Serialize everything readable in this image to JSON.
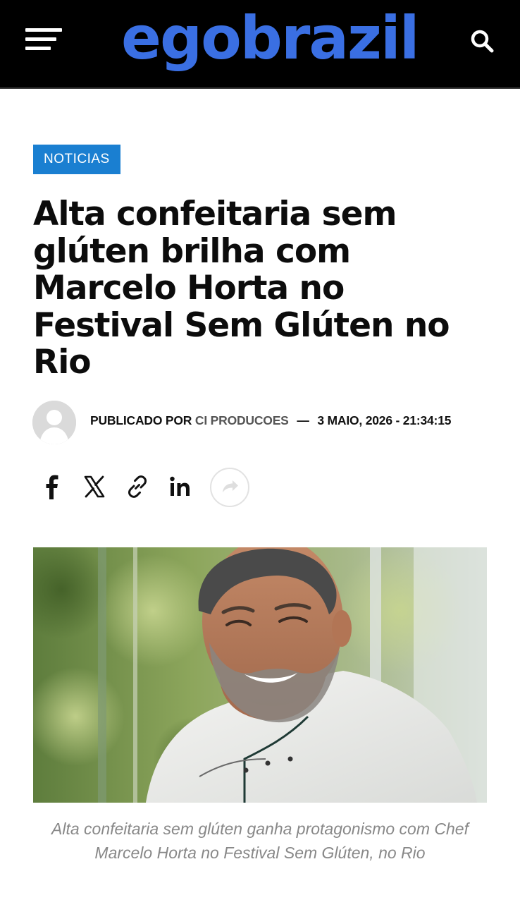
{
  "header": {
    "logo_text": "egobrazil",
    "logo_color": "#3a6fe3",
    "menu_icon": "hamburger-menu-icon",
    "search_icon": "search-icon"
  },
  "article": {
    "category": "NOTICIAS",
    "category_color": "#1a7fd1",
    "title": "Alta confeitaria sem glúten brilha com Marcelo Horta no Festival Sem Glúten no Rio",
    "byline": {
      "prefix": "PUBLICADO POR",
      "author": "CI PRODUCOES",
      "separator": "—",
      "date": "3 MAIO, 2026 - 21:34:15"
    },
    "share": {
      "icons": [
        "facebook-icon",
        "x-icon",
        "link-icon",
        "linkedin-icon",
        "share-more-icon"
      ]
    },
    "photo_caption": "Alta confeitaria sem glúten ganha protagonismo com Chef Marcelo Horta no Festival Sem Glúten, no Rio"
  }
}
